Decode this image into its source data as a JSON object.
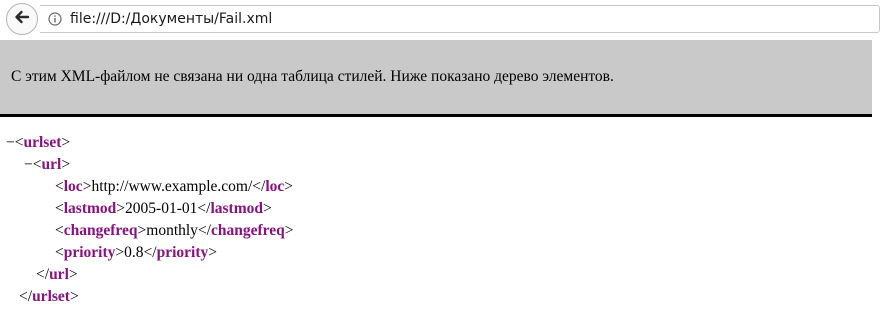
{
  "browser": {
    "url": "file:///D:/Документы/Fail.xml"
  },
  "notice": {
    "text": "С этим XML-файлом не связана ни одна таблица стилей. Ниже показано дерево элементов."
  },
  "tree": {
    "collapse_glyph": "−",
    "lt": "<",
    "gt": ">",
    "lt_slash": "</",
    "urlset": {
      "open_tag": "urlset",
      "close_tag": "urlset"
    },
    "url": {
      "open_tag": "url",
      "close_tag": "url"
    },
    "loc": {
      "tag": "loc",
      "value": "http://www.example.com/"
    },
    "lastmod": {
      "tag": "lastmod",
      "value": "2005-01-01"
    },
    "changefreq": {
      "tag": "changefreq",
      "value": "monthly"
    },
    "priority": {
      "tag": "priority",
      "value": "0.8"
    }
  },
  "colors": {
    "tag_name": "#881280",
    "notice_bg": "#c9c9c9"
  }
}
